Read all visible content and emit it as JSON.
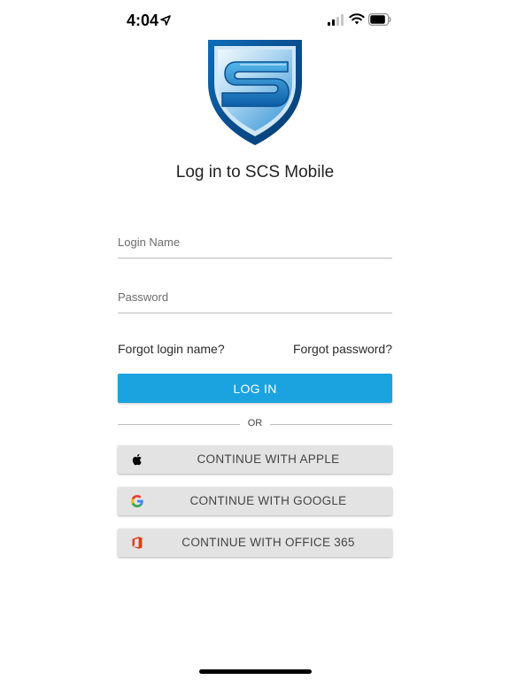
{
  "status_bar": {
    "time": "4:04",
    "icons": [
      "location-arrow-icon",
      "cellular-signal-icon",
      "wifi-icon",
      "battery-icon"
    ]
  },
  "logo": {
    "name": "scs-shield-logo",
    "text": "S"
  },
  "title": "Log in to SCS Mobile",
  "form": {
    "login_placeholder": "Login Name",
    "login_value": "",
    "password_placeholder": "Password",
    "password_value": ""
  },
  "links": {
    "forgot_login": "Forgot login name?",
    "forgot_password": "Forgot password?"
  },
  "login_button": "LOG IN",
  "divider": "OR",
  "sso": [
    {
      "label": "CONTINUE WITH APPLE",
      "icon": "apple-icon"
    },
    {
      "label": "CONTINUE WITH GOOGLE",
      "icon": "google-icon"
    },
    {
      "label": "CONTINUE WITH OFFICE 365",
      "icon": "office-365-icon"
    }
  ],
  "colors": {
    "primary": "#1aa3df",
    "sso_background": "#e3e3e3",
    "office": "#e23b18"
  }
}
